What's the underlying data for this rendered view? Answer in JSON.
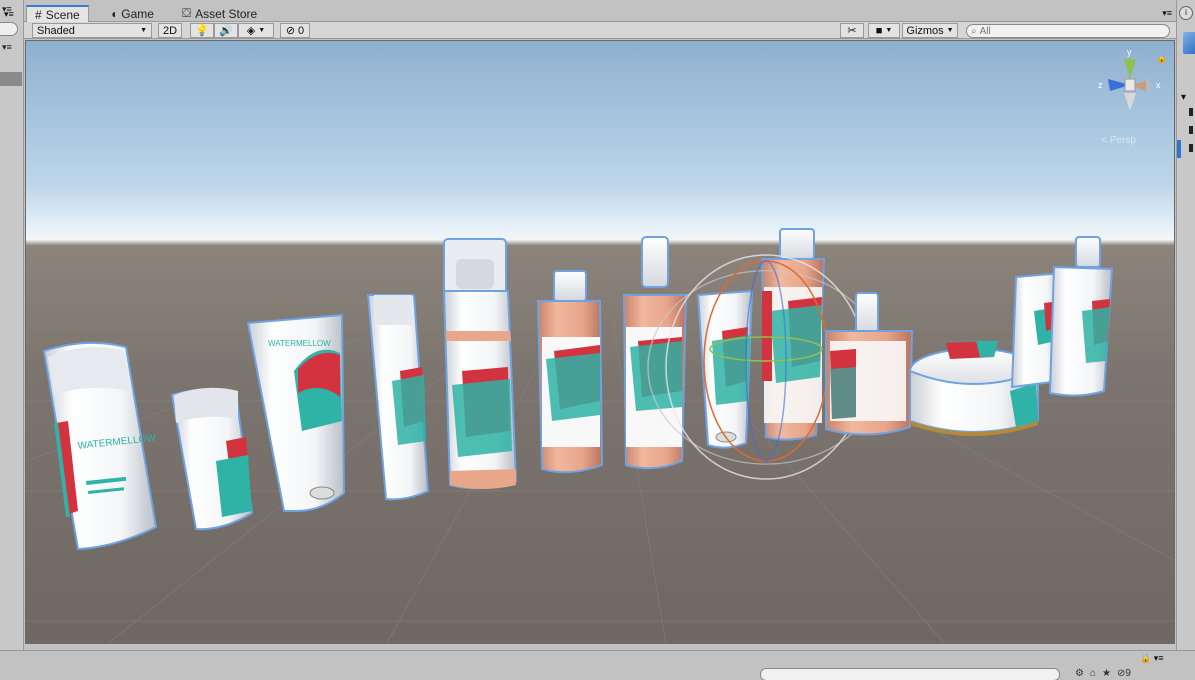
{
  "tabs": [
    {
      "label": "Scene",
      "icon": "grid-icon",
      "active": true
    },
    {
      "label": "Game",
      "icon": "pacman-icon",
      "active": false
    },
    {
      "label": "Asset Store",
      "icon": "bag-icon",
      "active": false
    }
  ],
  "toolbar": {
    "shading_mode": "Shaded",
    "mode_2d": "2D",
    "hidden_count": "0",
    "gizmos_label": "Gizmos",
    "search_placeholder": "All"
  },
  "viewport": {
    "projection_label": "Persp",
    "axes": {
      "x": "x",
      "y": "y",
      "z": "z"
    }
  },
  "bottom": {
    "hidden_objects_count": "9"
  },
  "colors": {
    "tab_accent": "#3c7bd6",
    "sky": "#8eb0d0",
    "ground": "#7c756f",
    "product_white": "#f6f7f8",
    "product_peach": "#e8a78b",
    "watermelon_teal": "#2fb3a6",
    "watermelon_red": "#d2333f",
    "selection_outline": "#6fa2e0"
  }
}
